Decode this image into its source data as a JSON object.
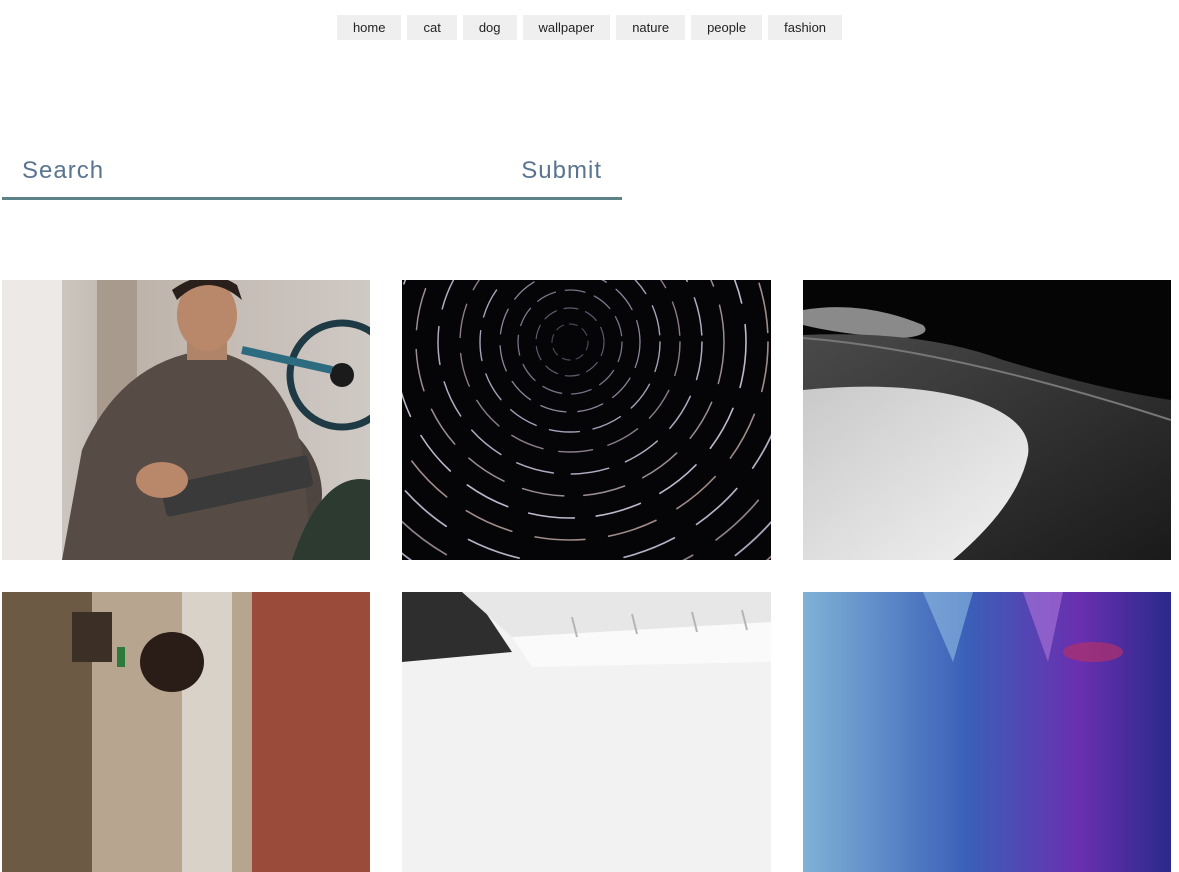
{
  "nav": {
    "items": [
      {
        "label": "home"
      },
      {
        "label": "cat"
      },
      {
        "label": "dog"
      },
      {
        "label": "wallpaper"
      },
      {
        "label": "nature"
      },
      {
        "label": "people"
      },
      {
        "label": "fashion"
      }
    ]
  },
  "search": {
    "placeholder": "Search",
    "value": "",
    "submit_label": "Submit"
  },
  "gallery": {
    "images": [
      {
        "subject": "woman in knit sweater writing on tablet"
      },
      {
        "subject": "star trails night sky"
      },
      {
        "subject": "black and white sand dunes"
      },
      {
        "subject": "person on city street"
      },
      {
        "subject": "white modern architecture"
      },
      {
        "subject": "blue and purple light rays"
      }
    ]
  },
  "colors": {
    "accent": "#5c8288",
    "search_text": "#5a7490",
    "nav_bg": "#efefef"
  }
}
